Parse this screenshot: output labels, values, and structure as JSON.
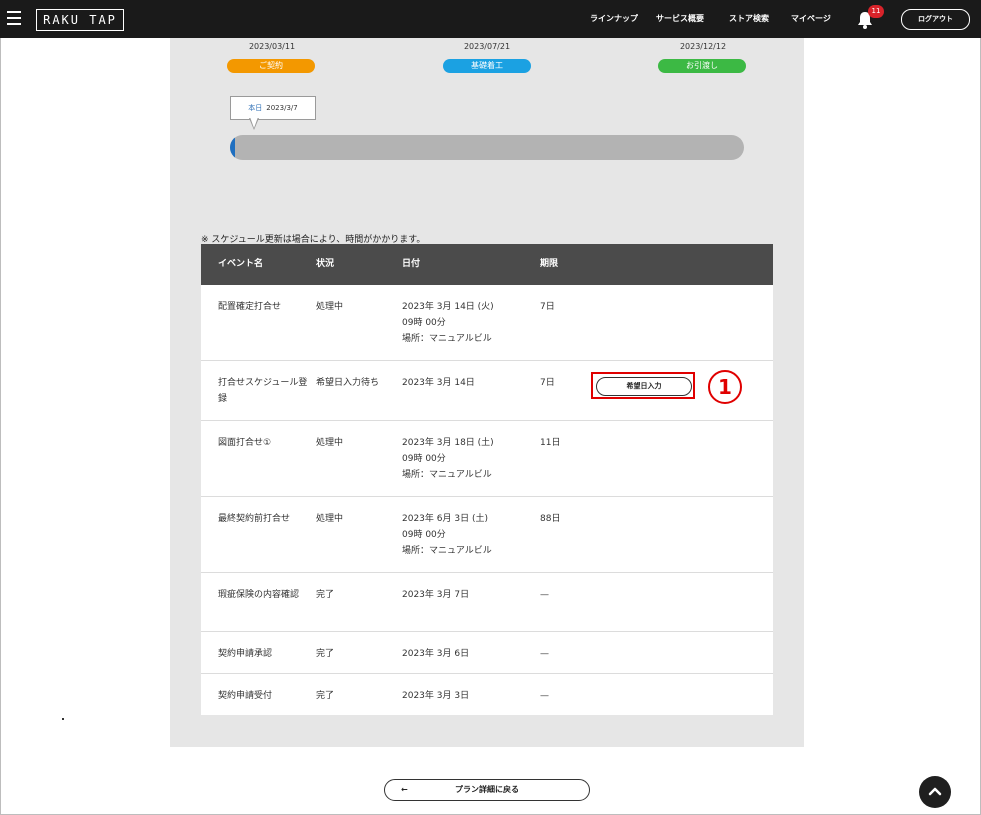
{
  "header": {
    "logo": "RAKU TAP",
    "nav": [
      "ラインナップ",
      "サービス概要",
      "ストア検索",
      "マイページ"
    ],
    "notification_count": "11",
    "logout_label": "ログアウト"
  },
  "timeline": {
    "milestones": [
      {
        "date": "2023/03/11",
        "label": "ご契約",
        "color": "#f39800"
      },
      {
        "date": "2023/07/21",
        "label": "基礎着工",
        "color": "#1ba1e2"
      },
      {
        "date": "2023/12/12",
        "label": "お引渡し",
        "color": "#3cb944"
      }
    ],
    "today_label": "本日",
    "today_date": "2023/3/7",
    "progress_percent": 1
  },
  "schedule": {
    "note": "※ スケジュール更新は場合により、時間がかかります。",
    "columns": [
      "イベント名",
      "状況",
      "日付",
      "期限"
    ],
    "rows": [
      {
        "name": "配置確定打合せ",
        "status": "処理中",
        "date": "2023年 3月 14日 (火)",
        "time": "09時 00分",
        "place": "場所：マニュアルビル",
        "deadline": "7日"
      },
      {
        "name": "打合せスケジュール登録",
        "status": "希望日入力待ち",
        "date": "2023年 3月 14日",
        "deadline": "7日",
        "action": "希望日入力",
        "marker": "1"
      },
      {
        "name": "図面打合せ①",
        "status": "処理中",
        "date": "2023年 3月 18日 (土)",
        "time": "09時 00分",
        "place": "場所：マニュアルビル",
        "deadline": "11日"
      },
      {
        "name": "最終契約前打合せ",
        "status": "処理中",
        "date": "2023年 6月 3日 (土)",
        "time": "09時 00分",
        "place": "場所：マニュアルビル",
        "deadline": "88日"
      },
      {
        "name": "瑕疵保険の内容確認",
        "status": "完了",
        "date": "2023年 3月 7日",
        "deadline": "—"
      },
      {
        "name": "契約申請承認",
        "status": "完了",
        "date": "2023年 3月 6日",
        "deadline": "—"
      },
      {
        "name": "契約申請受付",
        "status": "完了",
        "date": "2023年 3月 3日",
        "deadline": "—"
      }
    ]
  },
  "footer": {
    "back_arrow": "←",
    "back_label": "プラン詳細に戻る"
  }
}
